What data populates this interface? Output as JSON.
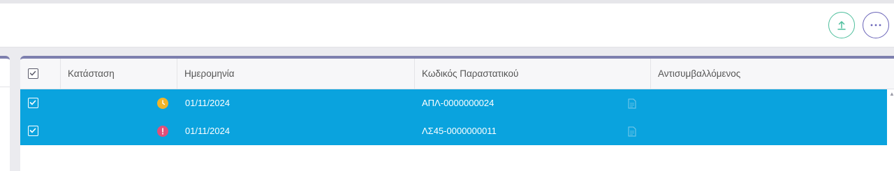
{
  "toolbar": {
    "upload_icon": "upload-icon",
    "more_icon": "more-horizontal-icon",
    "colors": {
      "upload_border": "#4fbf9d",
      "more_border": "#6a64b8"
    }
  },
  "grid": {
    "header_accent": "#7d7fae",
    "row_selected_color": "#0aa3de",
    "columns": {
      "status": "Κατάσταση",
      "date": "Ημερομηνία",
      "code": "Κωδικός Παραστατικού",
      "party": "Αντισυμβαλλόμενος"
    },
    "rows": [
      {
        "selected": true,
        "status_icon": "clock-icon",
        "status_color": "#f0b429",
        "date": "01/11/2024",
        "code": "ΑΠΛ-0000000024",
        "party": ""
      },
      {
        "selected": true,
        "status_icon": "error-icon",
        "status_color": "#e0507a",
        "date": "01/11/2024",
        "code": "ΛΣ45-0000000011",
        "party": ""
      }
    ]
  }
}
